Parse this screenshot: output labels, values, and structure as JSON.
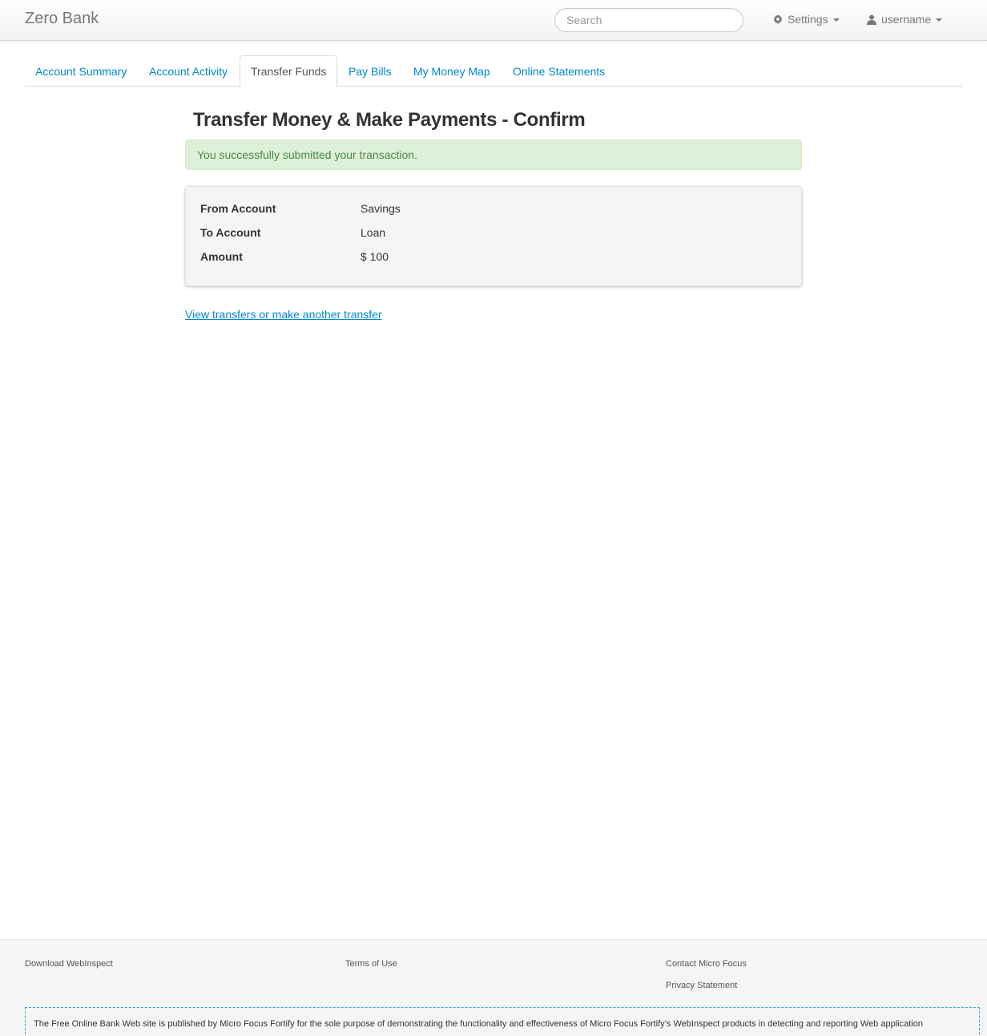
{
  "navbar": {
    "brand": "Zero Bank",
    "search_placeholder": "Search",
    "settings_label": "Settings",
    "user_label": "username"
  },
  "tabs": [
    {
      "label": "Account Summary",
      "active": false
    },
    {
      "label": "Account Activity",
      "active": false
    },
    {
      "label": "Transfer Funds",
      "active": true
    },
    {
      "label": "Pay Bills",
      "active": false
    },
    {
      "label": "My Money Map",
      "active": false
    },
    {
      "label": "Online Statements",
      "active": false
    }
  ],
  "main": {
    "title": "Transfer Money & Make Payments - Confirm",
    "alert": "You successfully submitted your transaction.",
    "details": [
      {
        "label": "From Account",
        "value": "Savings"
      },
      {
        "label": "To Account",
        "value": "Loan"
      },
      {
        "label": "Amount",
        "value": "$ 100"
      }
    ],
    "link": "View transfers or make another transfer"
  },
  "footer": {
    "download": "Download WebInspect",
    "terms": "Terms of Use",
    "contact": "Contact Micro Focus",
    "privacy": "Privacy Statement",
    "disclaimer": "The Free Online Bank Web site is published by Micro Focus Fortify for the sole purpose of demonstrating the functionality and effectiveness of Micro Focus Fortify’s WebInspect products in detecting and reporting Web application"
  },
  "colors": {
    "link": "#0088cc",
    "alert_bg": "#dff0d8",
    "alert_text": "#468847"
  }
}
